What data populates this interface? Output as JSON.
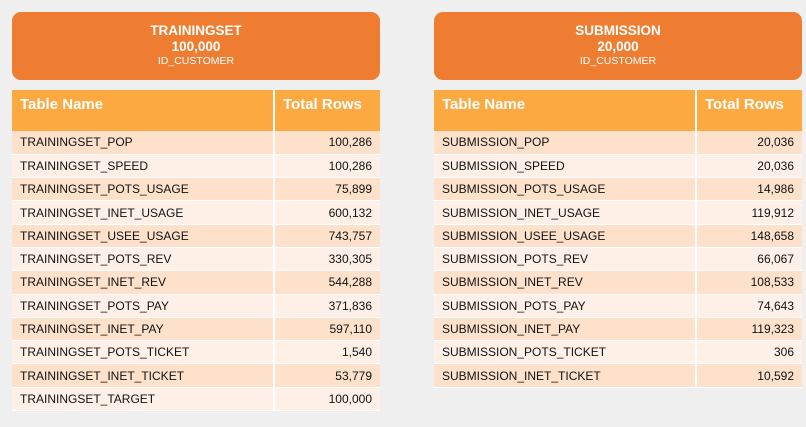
{
  "left": {
    "header": {
      "title": "TRAININGSET",
      "count": "100,000",
      "subtitle": "ID_CUSTOMER"
    },
    "columns": {
      "name": "Table Name",
      "rows": "Total Rows"
    },
    "rows": [
      {
        "name": "TRAININGSET_POP",
        "total": "100,286"
      },
      {
        "name": "TRAININGSET_SPEED",
        "total": "100,286"
      },
      {
        "name": "TRAININGSET_POTS_USAGE",
        "total": "75,899"
      },
      {
        "name": "TRAININGSET_INET_USAGE",
        "total": "600,132"
      },
      {
        "name": "TRAININGSET_USEE_USAGE",
        "total": "743,757"
      },
      {
        "name": "TRAININGSET_POTS_REV",
        "total": "330,305"
      },
      {
        "name": "TRAININGSET_INET_REV",
        "total": "544,288"
      },
      {
        "name": "TRAININGSET_POTS_PAY",
        "total": "371,836"
      },
      {
        "name": "TRAININGSET_INET_PAY",
        "total": "597,110"
      },
      {
        "name": "TRAININGSET_POTS_TICKET",
        "total": "1,540"
      },
      {
        "name": "TRAININGSET_INET_TICKET",
        "total": "53,779"
      },
      {
        "name": "TRAININGSET_TARGET",
        "total": "100,000"
      }
    ]
  },
  "right": {
    "header": {
      "title": "SUBMISSION",
      "count": "20,000",
      "subtitle": "ID_CUSTOMER"
    },
    "columns": {
      "name": "Table Name",
      "rows": "Total Rows"
    },
    "rows": [
      {
        "name": "SUBMISSION_POP",
        "total": "20,036"
      },
      {
        "name": "SUBMISSION_SPEED",
        "total": "20,036"
      },
      {
        "name": "SUBMISSION_POTS_USAGE",
        "total": "14,986"
      },
      {
        "name": "SUBMISSION_INET_USAGE",
        "total": "119,912"
      },
      {
        "name": "SUBMISSION_USEE_USAGE",
        "total": "148,658"
      },
      {
        "name": "SUBMISSION_POTS_REV",
        "total": "66,067"
      },
      {
        "name": "SUBMISSION_INET_REV",
        "total": "108,533"
      },
      {
        "name": "SUBMISSION_POTS_PAY",
        "total": "74,643"
      },
      {
        "name": "SUBMISSION_INET_PAY",
        "total": "119,323"
      },
      {
        "name": "SUBMISSION_POTS_TICKET",
        "total": "306"
      },
      {
        "name": "SUBMISSION_INET_TICKET",
        "total": "10,592"
      }
    ]
  },
  "colors": {
    "header_bg": "#ee7d31",
    "table_header_bg": "#fca942",
    "row_odd": "#fde1cb",
    "row_even": "#fef0e6"
  }
}
